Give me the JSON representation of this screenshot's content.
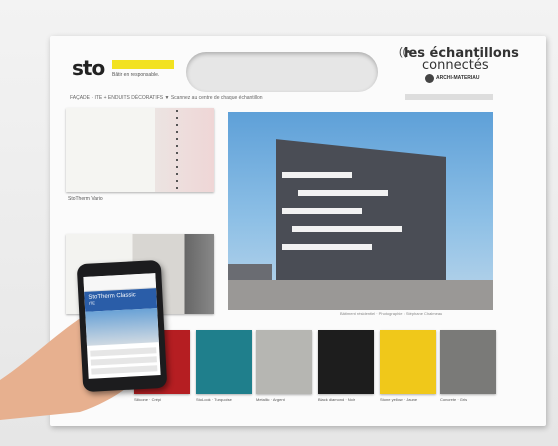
{
  "board": {
    "brand_logo": "sto",
    "tagline": "Bâtir en responsable.",
    "echantillons_top": "les échantillons",
    "echantillons_bottom": "connectés",
    "archi": "ARCHI-MATERIAU",
    "breadcrumb": "FAÇADE · ITE + ENDUITS DÉCORATIFS   ▼ Scannez au centre de chaque échantillon",
    "sample_top_label": "StoTherm Vario",
    "photo_caption": "Bâtiment résidentiel · Photographie : Stéphane Chalmeau"
  },
  "phone": {
    "title": "StoTherm Classic",
    "subtitle": "ITE"
  },
  "swatches": [
    {
      "label": "Silicone · Crépi",
      "color": "#b51e22"
    },
    {
      "label": "StoLook · Turquoise",
      "color": "#1f7f8c"
    },
    {
      "label": "Metallic · Argent",
      "color": "#b6b6b2"
    },
    {
      "label": "Black diamond · Noir",
      "color": "#1d1d1d"
    },
    {
      "label": "Stone yellow · Jaune",
      "color": "#f0c81a"
    },
    {
      "label": "Concrete · Gris",
      "color": "#7a7a78"
    }
  ]
}
